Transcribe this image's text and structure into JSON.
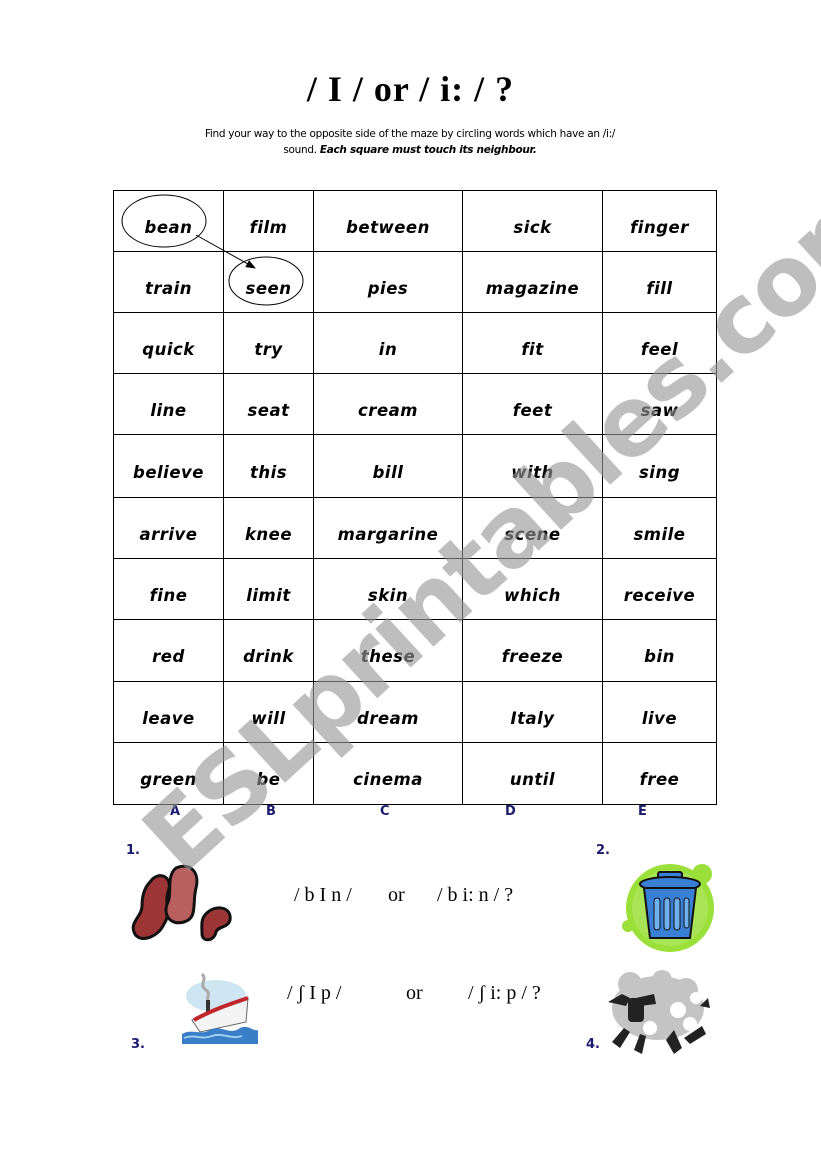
{
  "title": "/ I / or / i: / ?",
  "instructions": {
    "line1": "Find your way to the opposite side of the maze by circling words which have an /i:/",
    "line2_plain": "sound.  ",
    "line2_emphasis": "Each square must touch its neighbour."
  },
  "maze": {
    "rows": [
      [
        "bean",
        "film",
        "between",
        "sick",
        "finger"
      ],
      [
        "train",
        "seen",
        "pies",
        "magazine",
        "fill"
      ],
      [
        "quick",
        "try",
        "in",
        "fit",
        "feel"
      ],
      [
        "line",
        "seat",
        "cream",
        "feet",
        "saw"
      ],
      [
        "believe",
        "this",
        "bill",
        "with",
        "sing"
      ],
      [
        "arrive",
        "knee",
        "margarine",
        "scene",
        "smile"
      ],
      [
        "fine",
        "limit",
        "skin",
        "which",
        "receive"
      ],
      [
        "red",
        "drink",
        "these",
        "freeze",
        "bin"
      ],
      [
        "leave",
        "will",
        "dream",
        "Italy",
        "live"
      ],
      [
        "green",
        "be",
        "cinema",
        "until",
        "free"
      ]
    ],
    "column_labels": [
      "A",
      "B",
      "C",
      "D",
      "E"
    ],
    "circled_examples": [
      "bean",
      "seen"
    ]
  },
  "exercises": [
    {
      "number": "1.",
      "image": "beans-icon",
      "option_a": "/ b I n /",
      "joiner": "or",
      "option_b": "/ b i: n / ?"
    },
    {
      "number": "2.",
      "image": "trash-bin-icon"
    },
    {
      "number": "3.",
      "image": "ship-icon",
      "option_a": "/ ʃ I p /",
      "joiner": "or",
      "option_b": "/ ʃ i: p / ?"
    },
    {
      "number": "4.",
      "image": "sheep-icon"
    }
  ],
  "watermark": "ESLprintables.com",
  "colors": {
    "label_blue": "#1a1a6e",
    "bean_red": "#a33a3a",
    "bin_blue": "#3a7fd6",
    "bin_green": "#9be03a"
  }
}
